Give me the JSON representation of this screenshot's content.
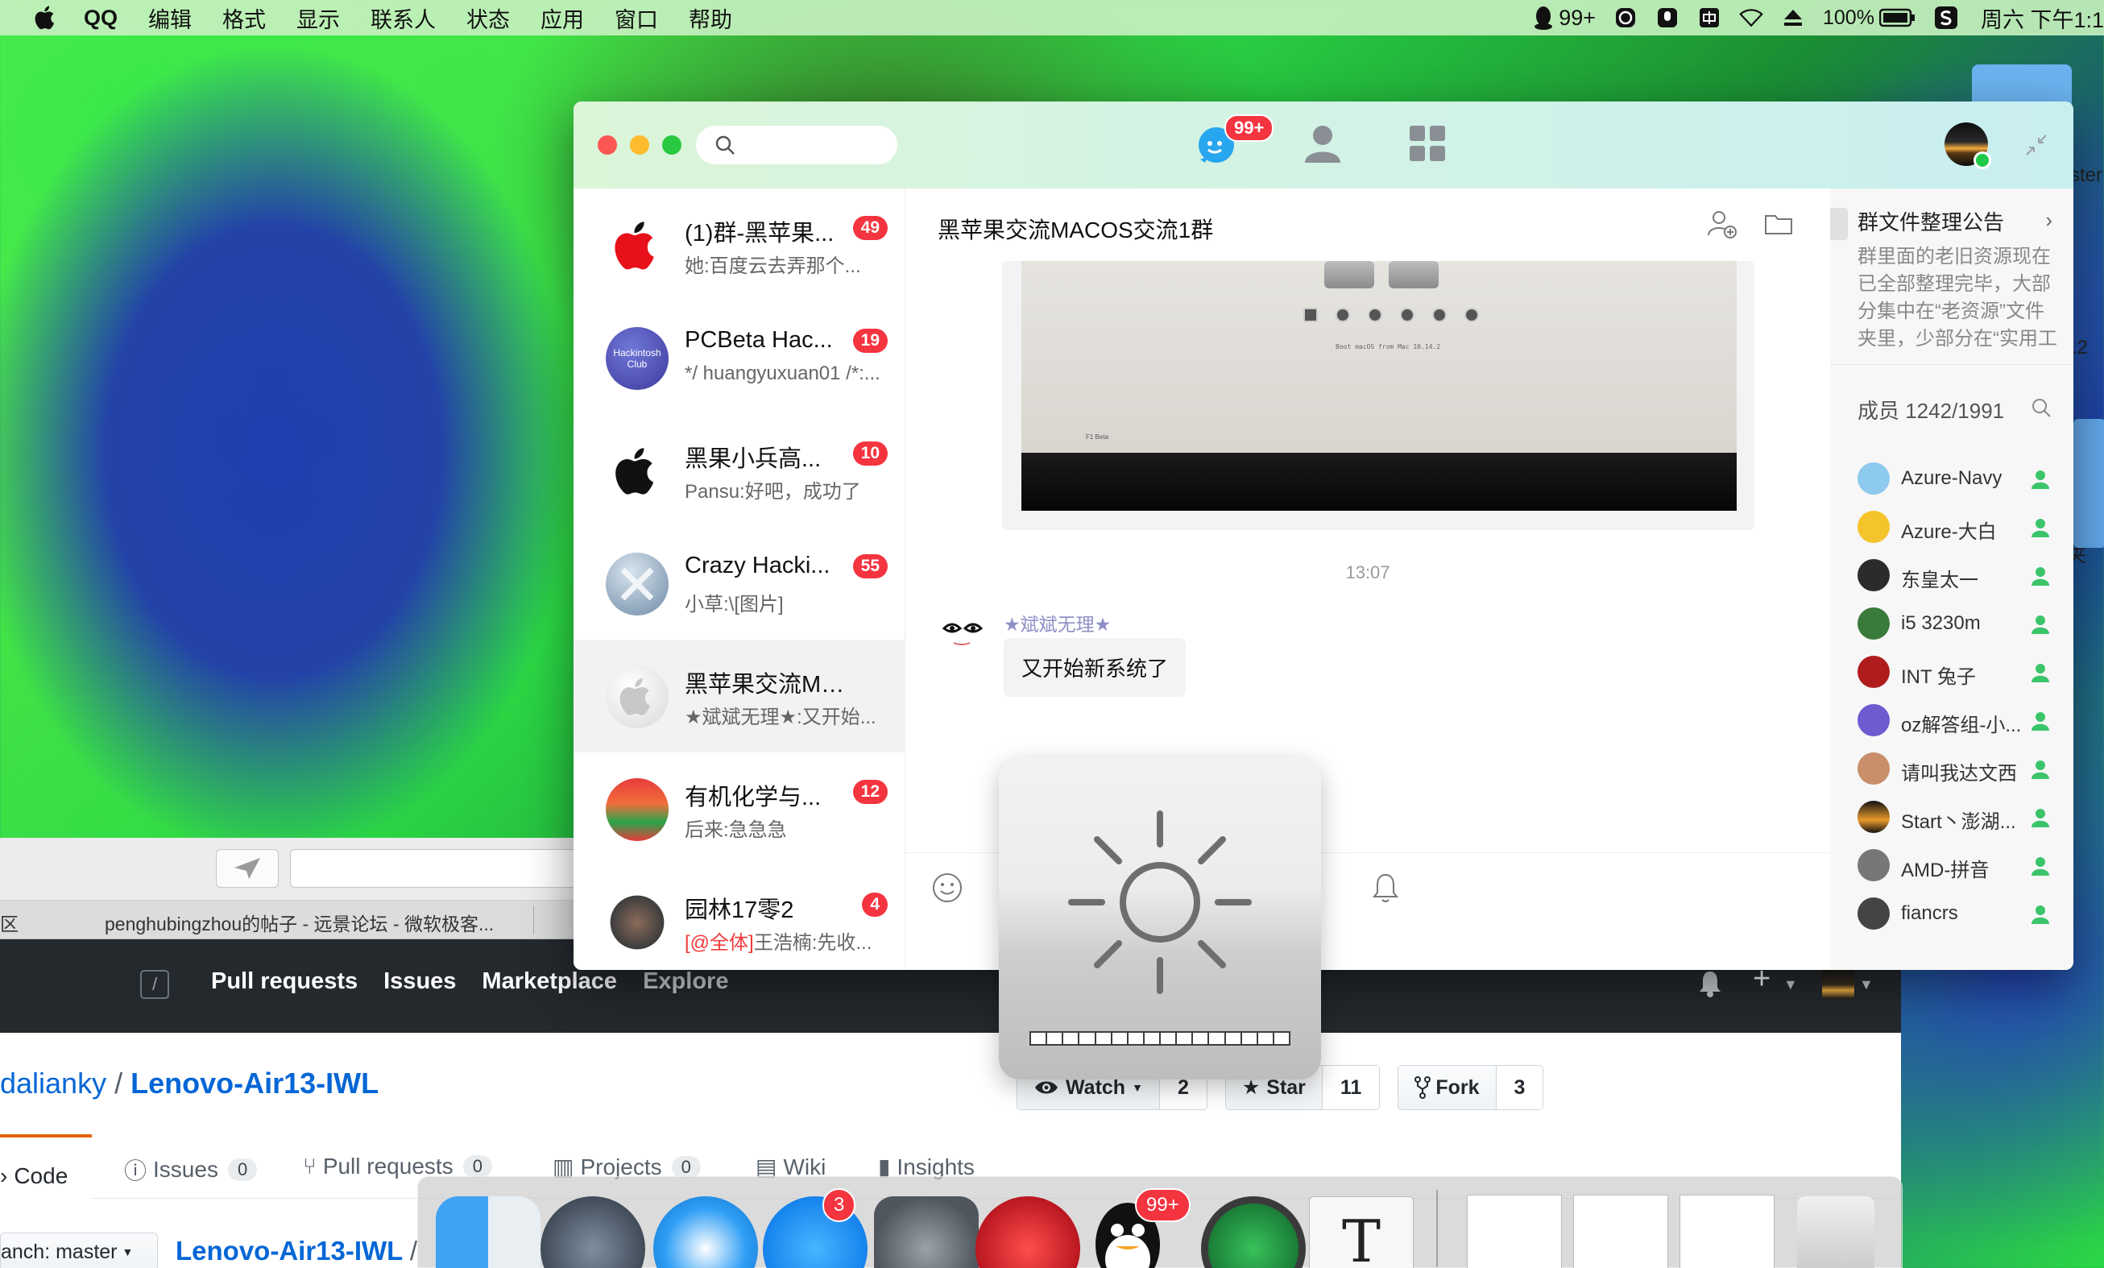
{
  "menubar": {
    "items": [
      "QQ",
      "编辑",
      "格式",
      "显示",
      "联系人",
      "状态",
      "应用",
      "窗口",
      "帮助"
    ],
    "qq_count": "99+",
    "battery": "100%",
    "clock": "周六 下午1:1"
  },
  "qq": {
    "nav_badge": "99+",
    "conversations": [
      {
        "title": "(1)群-黑苹果...",
        "preview": "她:百度云去弄那个...",
        "badge": "49"
      },
      {
        "title": "PCBeta Hac...",
        "preview": "*/ huangyuxuan01 /*:...",
        "badge": "19",
        "avatar_text": "Hackintosh Club"
      },
      {
        "title": "黑果小兵高...",
        "preview": "Pansu:好吧，成功了",
        "badge": "10"
      },
      {
        "title": "Crazy Hacki...",
        "preview": "小草:\\[图片]",
        "badge": "55"
      },
      {
        "title": "黑苹果交流MAC...",
        "preview": "★斌斌无理★:又开始...",
        "badge": ""
      },
      {
        "title": "有机化学与...",
        "preview": "后来:急急急",
        "badge": "12"
      },
      {
        "title": "园林17零2",
        "preview_at": "[@全体]",
        "preview": "王浩楠:先收...",
        "badge": "4"
      }
    ],
    "chat": {
      "title": "黑苹果交流MACOS交流1群",
      "boot_caption": "Boot macOS from Mac 10.14.2",
      "screen_left_text": "F1 Beta",
      "timestamp": "13:07",
      "sender": "★斌斌无理★",
      "message": "又开始新系统了"
    },
    "group": {
      "notice_title": "群文件整理公告",
      "notice_arrow": "›",
      "notice_body": "群里面的老旧资源现在已全部整理完毕，大部分集中在“老资源”文件夹里，少部分在“实用工具”和“教程集合”里。",
      "members_title": "成员 1242/1991",
      "members": [
        {
          "name": "Azure-Navy",
          "color": "#8ec9ee"
        },
        {
          "name": "Azure-大白",
          "color": "#f5c32c"
        },
        {
          "name": "东皇太一",
          "color": "#2b2b2b"
        },
        {
          "name": "i5 3230m",
          "color": "#3a7a3a"
        },
        {
          "name": "INT 兔子",
          "color": "#b01c1c"
        },
        {
          "name": "oz解答组-小...",
          "color": "#6d5bd0"
        },
        {
          "name": "请叫我达文西",
          "color": "#c98e6a"
        },
        {
          "name": "Start丶澎湖...",
          "color": "#e89a2a"
        },
        {
          "name": "AMD-拼音",
          "color": "#777777"
        },
        {
          "name": "fiancrs",
          "color": "#444444"
        }
      ]
    }
  },
  "browser": {
    "tab_left": "区",
    "tab_active": "penghubingzhou的帖子 - 远景论坛 - 微软极客...",
    "gh_nav": [
      "Pull requests",
      "Issues",
      "Marketplace",
      "Explore"
    ],
    "gh_slash": "/",
    "owner": "dalianky",
    "repo": "Lenovo-Air13-IWL",
    "watch_label": "Watch",
    "watch_count": "2",
    "star_label": "Star",
    "star_count": "11",
    "fork_label": "Fork",
    "fork_count": "3",
    "tabs": {
      "code": "Code",
      "issues": "Issues",
      "issues_count": "0",
      "pulls": "Pull requests",
      "pulls_count": "0",
      "projects": "Projects",
      "projects_count": "0",
      "wiki": "Wiki",
      "insights": "Insights"
    },
    "branch_label": "anch: master",
    "path": "Lenovo-Air13-IWL",
    "path_sep": "/"
  },
  "side_window": {
    "frag1": "ster",
    "frag2": ".2",
    "frag3": "件夹"
  },
  "dock": {
    "appstore_badge": "3",
    "qq_badge": "99+",
    "typora_letter": "T"
  }
}
